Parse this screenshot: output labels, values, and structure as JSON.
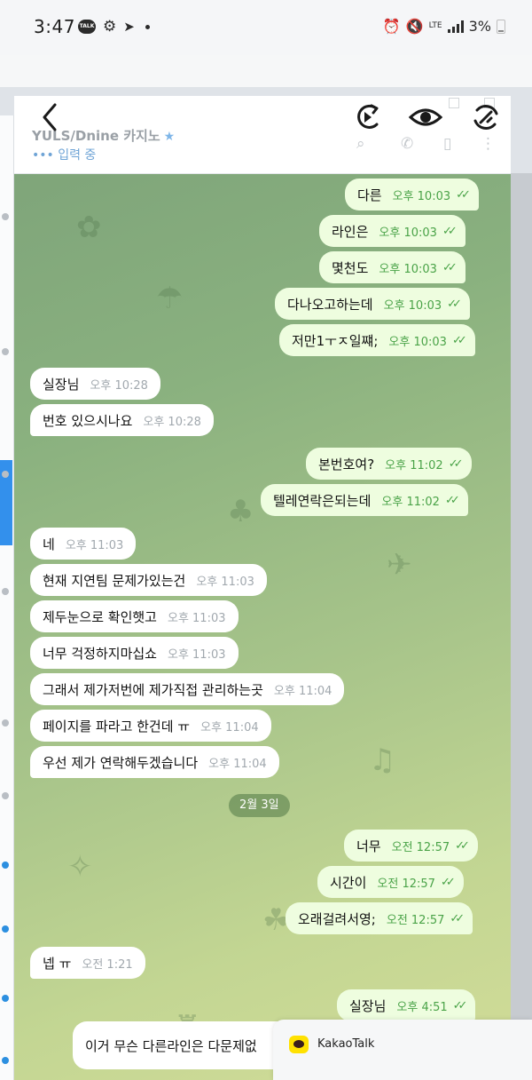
{
  "status_bar": {
    "time": "3:47",
    "talk_badge": "TALK",
    "network": "LTE",
    "battery": "3%"
  },
  "chat": {
    "title": "YULS/Dnine 카지노",
    "typing": "••• 입력 중",
    "date_separator": "2월 3일",
    "messages": [
      {
        "dir": "out",
        "text": "다른",
        "time": "오후 10:03"
      },
      {
        "dir": "out",
        "text": "라인은",
        "time": "오후 10:03"
      },
      {
        "dir": "out",
        "text": "몇천도",
        "time": "오후 10:03"
      },
      {
        "dir": "out",
        "text": "다나오고하는데",
        "time": "오후 10:03"
      },
      {
        "dir": "out",
        "text": "저만1ㅜㅈ일쨰;",
        "time": "오후 10:03"
      },
      {
        "dir": "in",
        "text": "실장님",
        "time": "오후 10:28"
      },
      {
        "dir": "in",
        "text": "번호 있으시나요",
        "time": "오후 10:28"
      },
      {
        "dir": "out",
        "text": "본번호여?",
        "time": "오후 11:02"
      },
      {
        "dir": "out",
        "text": "텔레연락은되는데",
        "time": "오후 11:02"
      },
      {
        "dir": "in",
        "text": "네",
        "time": "오후 11:03"
      },
      {
        "dir": "in",
        "text": "현재 지연팀 문제가있는건",
        "time": "오후 11:03"
      },
      {
        "dir": "in",
        "text": "제두눈으로 확인햇고",
        "time": "오후 11:03"
      },
      {
        "dir": "in",
        "text": "너무 걱정하지마십쇼",
        "time": "오후 11:03"
      },
      {
        "dir": "in",
        "text": "그래서 제가저번에 제가직접 관리하는곳",
        "time": "오후 11:04"
      },
      {
        "dir": "in",
        "text": "페이지를 파라고 한건데 ㅠ",
        "time": "오후 11:04"
      },
      {
        "dir": "in",
        "text": "우선 제가 연락해두겠습니다",
        "time": "오후 11:04"
      },
      {
        "dir": "out",
        "text": "너무",
        "time": "오전 12:57"
      },
      {
        "dir": "out",
        "text": "시간이",
        "time": "오전 12:57"
      },
      {
        "dir": "out",
        "text": "오래걸려서영;",
        "time": "오전 12:57"
      },
      {
        "dir": "in",
        "text": "넵 ㅠ",
        "time": "오전 1:21"
      },
      {
        "dir": "out",
        "text": "실장님",
        "time": "오후 4:51"
      },
      {
        "dir": "in",
        "text": "이거 무슨 다른라인은 다문제없",
        "time": ""
      }
    ]
  },
  "notification": {
    "app_name": "KakaoTalk"
  },
  "colors": {
    "outgoing_bubble": "#eefddf",
    "incoming_bubble": "#ffffff",
    "time_green": "#4aa348",
    "telegram_blue": "#3390ec",
    "kakao_yellow": "#ffe100"
  }
}
